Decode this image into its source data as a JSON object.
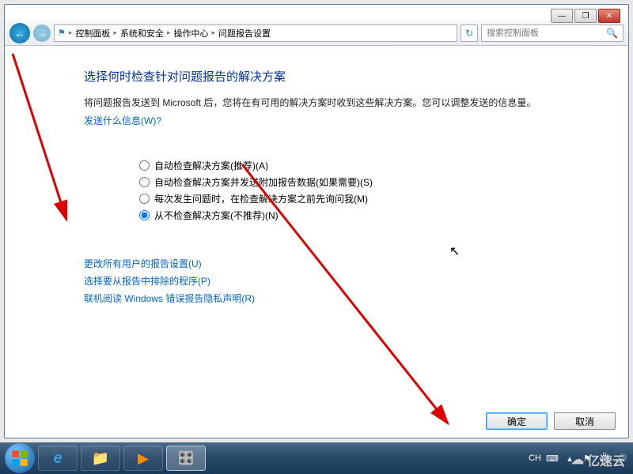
{
  "titlebar": {
    "min": "—",
    "max": "❐",
    "close": "✕"
  },
  "nav": {
    "back": "←",
    "fwd": "→",
    "refresh": "↻"
  },
  "breadcrumb": {
    "items": [
      "控制面板",
      "系统和安全",
      "操作中心",
      "问题报告设置"
    ],
    "sep": "▸"
  },
  "search": {
    "placeholder": "搜索控制面板"
  },
  "main": {
    "heading": "选择何时检查针对问题报告的解决方案",
    "subtext": "将问题报告发送到 Microsoft 后，您将在有可用的解决方案时收到这些解决方案。您可以调整发送的信息量。",
    "meta_link": "发送什么信息(W)?",
    "radios": [
      "自动检查解决方案(推荐)(A)",
      "自动检查解决方案并发送附加报告数据(如果需要)(S)",
      "每次发生问题时，在检查解决方案之前先询问我(M)",
      "从不检查解决方案(不推荐)(N)"
    ],
    "selected_index": 3,
    "links": [
      "更改所有用户的报告设置(U)",
      "选择要从报告中排除的程序(P)",
      "联机阅读 Windows 错误报告隐私声明(R)"
    ]
  },
  "buttons": {
    "ok": "确定",
    "cancel": "取消"
  },
  "tray": {
    "ime": "CH",
    "kb": "⌨"
  },
  "watermark": "亿速云"
}
